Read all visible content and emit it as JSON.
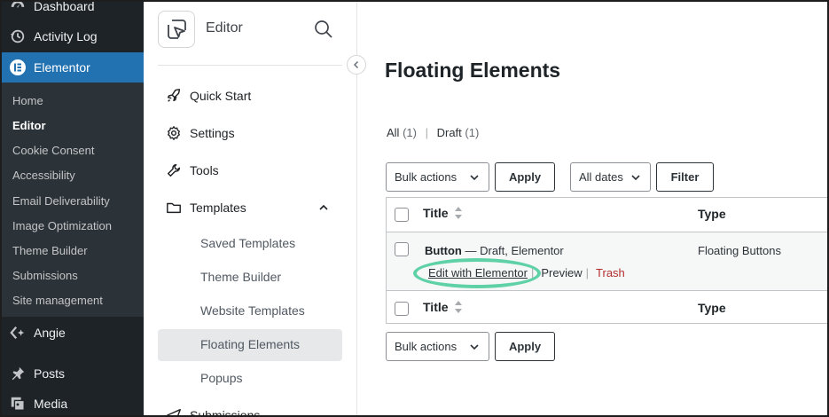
{
  "wp_sidebar": {
    "menu": [
      {
        "id": "dashboard",
        "label": "Dashboard",
        "icon": "dashboard-icon"
      },
      {
        "id": "activity-log",
        "label": "Activity Log",
        "icon": "history-icon"
      },
      {
        "id": "elementor",
        "label": "Elementor",
        "icon": "elementor-icon",
        "active": true
      }
    ],
    "submenu": [
      {
        "label": "Home"
      },
      {
        "label": "Editor",
        "current": true
      },
      {
        "label": "Cookie Consent"
      },
      {
        "label": "Accessibility"
      },
      {
        "label": "Email Deliverability"
      },
      {
        "label": "Image Optimization"
      },
      {
        "label": "Theme Builder"
      },
      {
        "label": "Submissions"
      },
      {
        "label": "Site management"
      }
    ],
    "lower_menu": [
      {
        "id": "angie",
        "label": "Angie",
        "icon": "angie-icon"
      },
      {
        "id": "posts",
        "label": "Posts",
        "icon": "pushpin-icon"
      },
      {
        "id": "media",
        "label": "Media",
        "icon": "media-icon"
      }
    ]
  },
  "panel": {
    "title": "Editor",
    "nav": [
      {
        "id": "quick-start",
        "label": "Quick Start",
        "icon": "rocket-icon"
      },
      {
        "id": "settings",
        "label": "Settings",
        "icon": "gear-icon"
      },
      {
        "id": "tools",
        "label": "Tools",
        "icon": "wrench-icon"
      },
      {
        "id": "templates",
        "label": "Templates",
        "icon": "folder-icon"
      }
    ],
    "templates_sub": [
      {
        "label": "Saved Templates"
      },
      {
        "label": "Theme Builder"
      },
      {
        "label": "Website Templates"
      },
      {
        "label": "Floating Elements",
        "active": true
      },
      {
        "label": "Popups"
      }
    ],
    "submissions_label": "Submissions"
  },
  "main": {
    "title": "Floating Elements",
    "filters": {
      "all_label": "All",
      "all_count": "(1)",
      "sep": "|",
      "draft_label": "Draft",
      "draft_count": "(1)"
    },
    "bulk_actions": "Bulk actions",
    "apply": "Apply",
    "all_dates": "All dates",
    "filter": "Filter",
    "columns": {
      "title": "Title",
      "type": "Type"
    },
    "row": {
      "title": "Button",
      "status": " — Draft, Elementor",
      "type": "Floating Buttons",
      "actions": {
        "edit": "Edit with Elementor",
        "sep": "|",
        "preview": "Preview",
        "trash": "Trash"
      }
    }
  },
  "colors": {
    "wp_sidebar_bg": "#1d2327",
    "wp_active": "#2271b1",
    "trash": "#b32d2e",
    "highlight": "#5fd1a6"
  }
}
